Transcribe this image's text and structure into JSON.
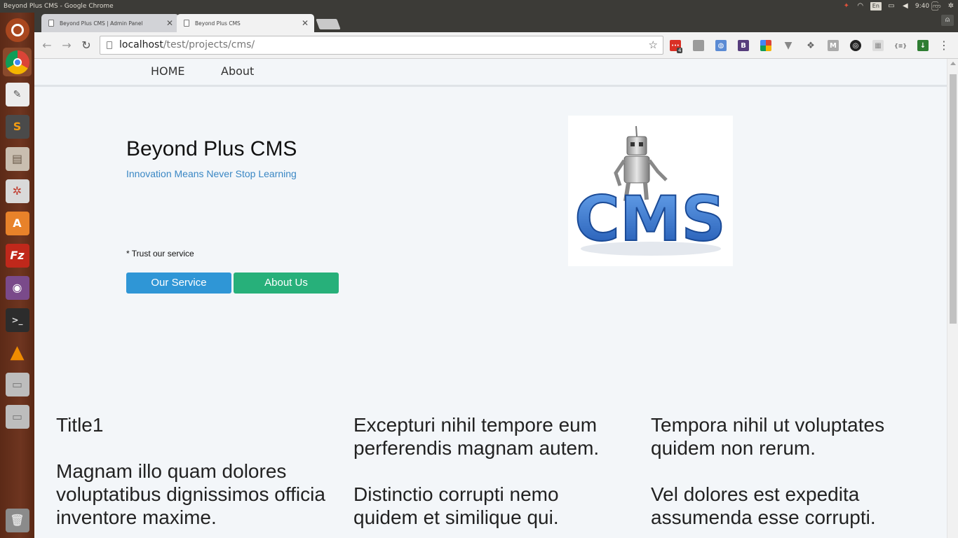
{
  "system": {
    "window_title": "Beyond Plus CMS - Google Chrome",
    "keyboard": "En",
    "time": "9:40 ကြာ"
  },
  "browser": {
    "tabs": [
      {
        "label": "Beyond Plus CMS | Admin Panel",
        "active": false
      },
      {
        "label": "Beyond Plus CMS",
        "active": true
      }
    ],
    "url_host": "localhost",
    "url_path": "/test/projects/cms/",
    "extension_badge": "4",
    "ext_bootstrap_label": "B",
    "ext_m_label": "M",
    "ext_json_label": "{≡}"
  },
  "site": {
    "nav": {
      "home": "HOME",
      "about": "About"
    },
    "hero": {
      "title": "Beyond Plus CMS",
      "subtitle": "Innovation Means Never Stop Learning",
      "trust": "* Trust our service",
      "btn_service": "Our Service",
      "btn_about": "About Us",
      "image_text": "CMS"
    },
    "columns": [
      {
        "title": "Title1",
        "body": "Magnam illo quam dolores voluptatibus dignissimos officia inventore maxime."
      },
      {
        "title": "Excepturi nihil tempore eum perferendis magnam autem.",
        "body": "Distinctio corrupti nemo quidem et similique qui."
      },
      {
        "title": "Tempora nihil ut voluptates quidem non rerum.",
        "body": "Vel dolores est expedita assumenda esse corrupti."
      }
    ]
  },
  "colors": {
    "launcher": "#6e3520",
    "service_button": "#2f96d6",
    "about_button": "#27b07a",
    "subtitle": "#3a87c4",
    "cms_letters": "#2a6fc9"
  }
}
